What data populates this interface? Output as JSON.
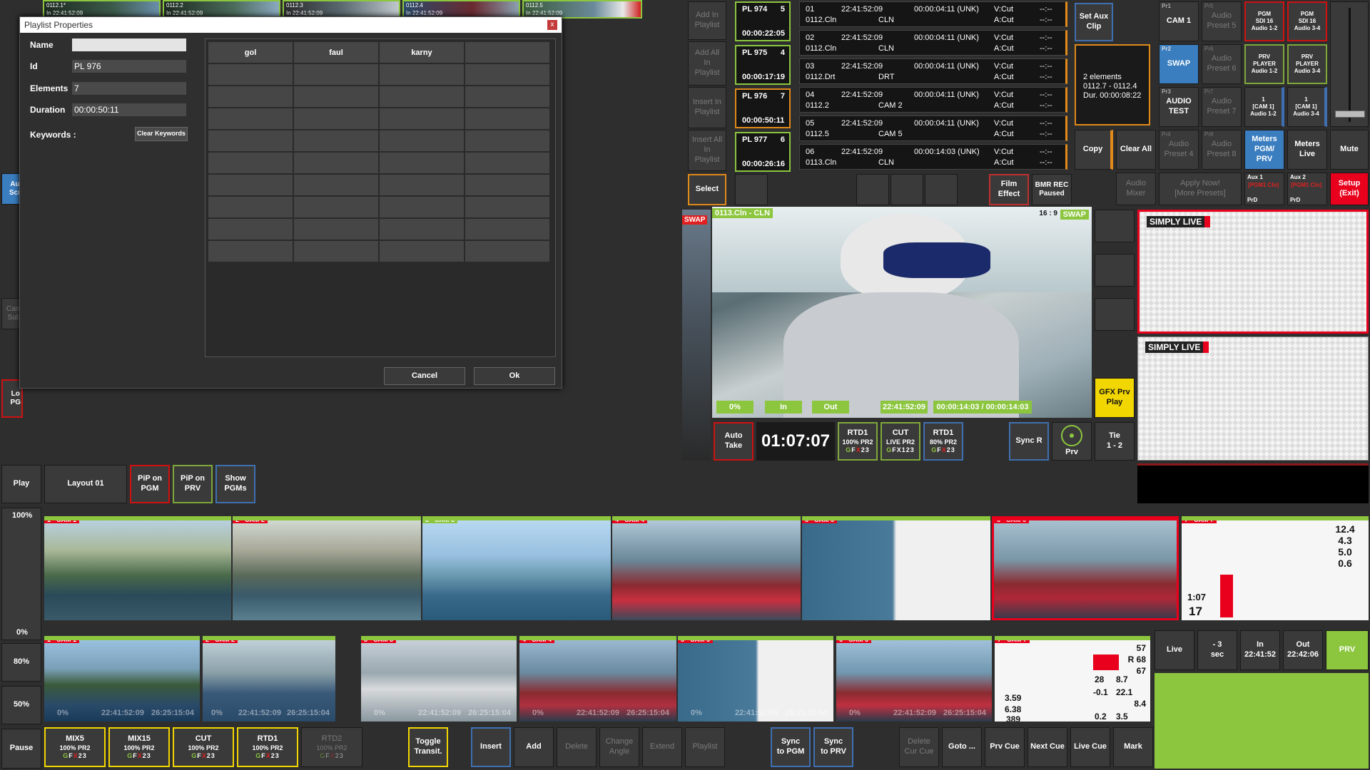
{
  "top_strip": [
    {
      "label": "0112.1*",
      "time": "22:41:52:09"
    },
    {
      "label": "0112.2",
      "time": "22:41:52:09"
    },
    {
      "label": "0112.3",
      "time": "22:41:52:09"
    },
    {
      "label": "0112.4",
      "time": "22:41:52:09"
    },
    {
      "label": "0112.5",
      "time": "22:41:52:09"
    }
  ],
  "in_prefix": "In",
  "dialog": {
    "title": "Playlist Properties",
    "close": "x",
    "name_label": "Name",
    "name_value": "",
    "id_label": "Id",
    "id_value": "PL 976",
    "elements_label": "Elements",
    "elements_value": "7",
    "duration_label": "Duration",
    "duration_value": "00:00:50:11",
    "keywords_label": "Keywords :",
    "clear_keywords": "Clear Keywords",
    "keywords": [
      "gol",
      "faul",
      "karny",
      ""
    ],
    "cancel": "Cancel",
    "ok": "Ok"
  },
  "left_col": {
    "au": "Au\nScr",
    "cam_sub": "Cam\nSub",
    "lo_pg": "Lo\nPG"
  },
  "playlist_actions": [
    "Add In\nPlaylist",
    "Add All\nIn\nPlaylist",
    "Insert In\nPlaylist",
    "Insert All\nIn\nPlaylist",
    "Select"
  ],
  "playlists": [
    {
      "name": "PL 974",
      "count": "5",
      "dur": "00:00:22:05"
    },
    {
      "name": "PL 975",
      "count": "4",
      "dur": "00:00:17:19"
    },
    {
      "name": "PL 976",
      "count": "7",
      "dur": "00:00:50:11"
    },
    {
      "name": "PL 977",
      "count": "6",
      "dur": "00:00:26:16"
    }
  ],
  "clips": [
    {
      "n": "01",
      "time": "22:41:52:09",
      "dur": "00:00:04:11 (UNK)",
      "name": "0112.Cln",
      "cam": "CLN",
      "v": "V:Cut",
      "a": "A:Cut",
      "x": "--:--"
    },
    {
      "n": "02",
      "time": "22:41:52:09",
      "dur": "00:00:04:11 (UNK)",
      "name": "0112.Cln",
      "cam": "CLN",
      "v": "V:Cut",
      "a": "A:Cut",
      "x": "--:--"
    },
    {
      "n": "03",
      "time": "22:41:52:09",
      "dur": "00:00:04:11 (UNK)",
      "name": "0112.Drt",
      "cam": "DRT",
      "v": "V:Cut",
      "a": "A:Cut",
      "x": "--:--"
    },
    {
      "n": "04",
      "time": "22:41:52:09",
      "dur": "00:00:04:11 (UNK)",
      "name": "0112.2",
      "cam": "CAM 2",
      "v": "V:Cut",
      "a": "A:Cut",
      "x": "--:--"
    },
    {
      "n": "05",
      "time": "22:41:52:09",
      "dur": "00:00:04:11 (UNK)",
      "name": "0112.5",
      "cam": "CAM 5",
      "v": "V:Cut",
      "a": "A:Cut",
      "x": "--:--"
    },
    {
      "n": "06",
      "time": "22:41:52:09",
      "dur": "00:00:14:03 (UNK)",
      "name": "0113.Cln",
      "cam": "CLN",
      "v": "V:Cut",
      "a": "A:Cut",
      "x": "--:--"
    }
  ],
  "set_aux_clip": "Set Aux\nClip",
  "summary": "2 elements\n0112.7 - 0112.4\nDur. 00:00:08:22",
  "copy": "Copy",
  "clear_all": "Clear All",
  "film_effect": "Film\nEffect",
  "bmr_rec": "BMR REC\nPaused",
  "presets": [
    {
      "tag": "Pr1",
      "label": "CAM 1"
    },
    {
      "tag": "Pr5",
      "label": "Audio\nPreset 5"
    },
    {
      "tag": "Pr2",
      "label": "SWAP"
    },
    {
      "tag": "Pr6",
      "label": "Audio\nPreset 6"
    },
    {
      "tag": "Pr3",
      "label": "AUDIO\nTEST"
    },
    {
      "tag": "Pr7",
      "label": "Audio\nPreset 7"
    },
    {
      "tag": "Pr4",
      "label": "Audio\nPreset 4"
    },
    {
      "tag": "Pr8",
      "label": "Audio\nPreset 8"
    }
  ],
  "audio_routes": [
    "PGM\nSDI 16\nAudio 1-2",
    "PGM\nSDI 16\nAudio 3-4",
    "PRV\nPLAYER\nAudio 1-2",
    "PRV\nPLAYER\nAudio 3-4",
    "1\n[CAM 1]\nAudio 1-2",
    "1\n[CAM 1]\nAudio 3-4"
  ],
  "meters_pgm_prv": "Meters\nPGM/\nPRV",
  "meters_live": "Meters\nLive",
  "mute": "Mute",
  "audio_mixer": "Audio\nMixer",
  "apply_now": "Apply Now!\n[More Presets]",
  "aux1": {
    "title": "Aux 1",
    "sub": "[PGM1 Cln]",
    "foot": "PrD"
  },
  "aux2": {
    "title": "Aux 2",
    "sub": "[PGM1 Cln]",
    "foot": "PrD"
  },
  "setup_exit": "Setup\n(Exit)",
  "viewer": {
    "label": "0113.Cln - CLN",
    "ratio": "16 : 9",
    "swap": "SWAP",
    "pct": "0%",
    "in": "In",
    "out": "Out",
    "tc_time": "22:41:52:09",
    "tc_dur": "00:00:14:03 / 00:00:14:03"
  },
  "gfx_prv_play": "GFX Prv\nPlay",
  "swap_left": "SWAP",
  "auto_take": "Auto\nTake",
  "clock": "01:07:07",
  "transitions_top": [
    {
      "l1": "RTD1",
      "l2": "100% PR2"
    },
    {
      "l1": "CUT",
      "l2": "LIVE PR2"
    },
    {
      "l1": "RTD1",
      "l2": "80% PR2"
    }
  ],
  "gfx_tag": {
    "g": "G",
    "f": "F",
    "x": "X",
    "n1": "1",
    "n2": "2",
    "n3": "3"
  },
  "sync_r": "Sync R",
  "prv_label": "Prv",
  "tie": "Tie\n1 - 2",
  "simply_live": "SIMPLY LIVE",
  "left_controls": {
    "play": "Play",
    "pct100": "100%",
    "pct0": "0%",
    "pct80": "80%",
    "pct50": "50%",
    "pause": "Pause"
  },
  "layout_btns": [
    "Layout 01",
    "PiP on\nPGM",
    "PiP on\nPRV",
    "Show\nPGMs"
  ],
  "cams_row1": [
    "1 - CAM 1",
    "2 - CAM 2",
    "3 - CAM 3",
    "4 - CAM 4",
    "5 - CAM 5",
    "6 - CAM 6",
    "7 - CAM 7"
  ],
  "cams_row2": [
    "1 - CAM 1",
    "2 - CAM 2",
    "3 - CAM 3",
    "4 - CAM 4",
    "5 - CAM 5",
    "6 - CAM 6",
    "7 - CAM 7"
  ],
  "row2_overlay": {
    "pct": "0%",
    "t1": "22:41:52:09",
    "t2": "26:25:15:04"
  },
  "cam7_nums": [
    "12.4",
    "4.3",
    "5.0",
    "0.6",
    "1:07",
    "17"
  ],
  "cam7b_nums": [
    "57",
    "R 68",
    "67",
    "28",
    "8.7",
    "-0.1",
    "22.1",
    "8.4",
    "3.59",
    "6.38",
    "0.2",
    "3.5",
    "389"
  ],
  "right_live": {
    "live": "Live",
    "minus3": "- 3\nsec",
    "in": "In\n22:41:52",
    "out": "Out\n22:42:06",
    "prv": "PRV"
  },
  "bottom_transitions": [
    {
      "l1": "MIX5",
      "l2": "100% PR2"
    },
    {
      "l1": "MIX15",
      "l2": "100% PR2"
    },
    {
      "l1": "CUT",
      "l2": "100% PR2"
    },
    {
      "l1": "RTD1",
      "l2": "100% PR2"
    },
    {
      "l1": "RTD2",
      "l2": "100% PR2"
    }
  ],
  "toggle_transit": "Toggle\nTransit.",
  "bottom_btns": [
    "Insert",
    "Add",
    "Delete",
    "Change\nAngle",
    "Extend",
    "Playlist"
  ],
  "sync_pgm": "Sync\nto PGM",
  "sync_prv": "Sync\nto PRV",
  "delete_cur_cue": "Delete\nCur Cue",
  "goto": "Goto ...",
  "cue_btns": [
    "Prv Cue",
    "Next Cue",
    "Live Cue",
    "Mark"
  ],
  "colors": {
    "accent_green": "#8cc63f",
    "alert_red": "#e8001c",
    "selection_orange": "#e08a1a",
    "rec_blue": "#3f6fb0"
  }
}
